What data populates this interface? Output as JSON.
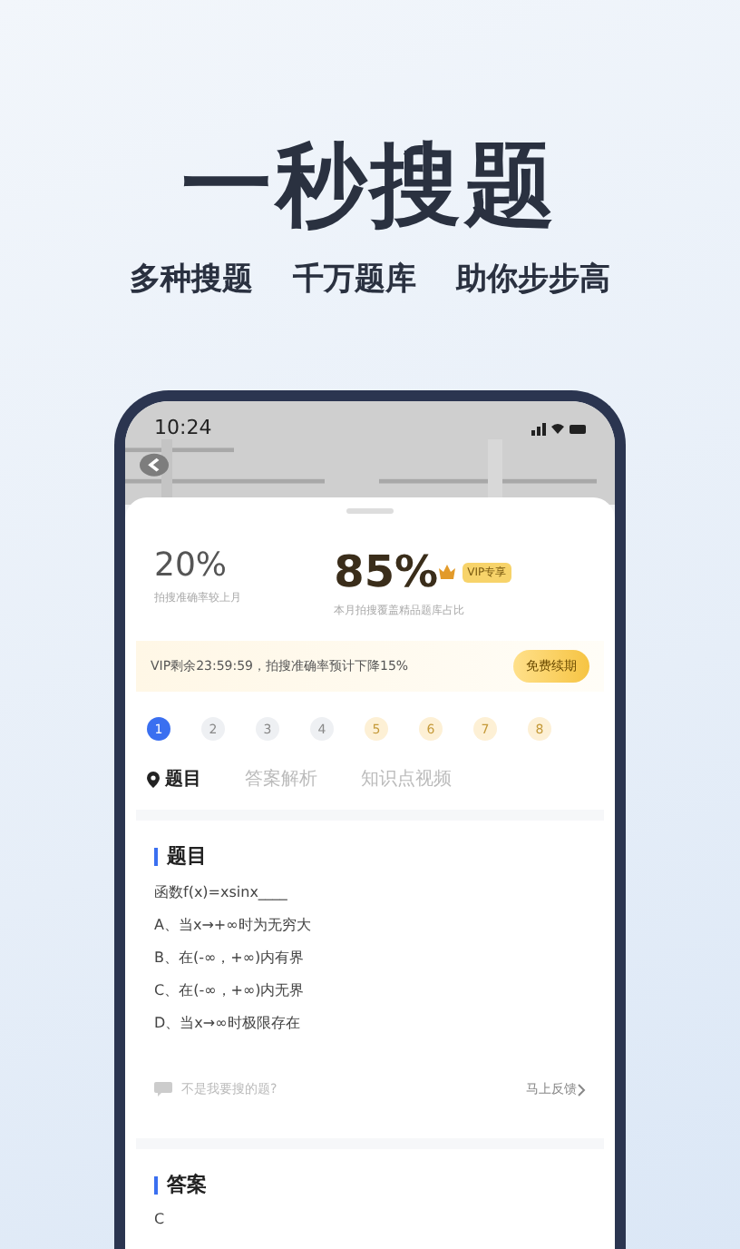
{
  "headline": "一秒搜题",
  "taglines": [
    "多种搜题",
    "千万题库",
    "助你步步高"
  ],
  "status_bar": {
    "time": "10:24"
  },
  "camera": {
    "kind": "picture"
  },
  "stats": [
    {
      "value": "20%",
      "caption": "拍搜准确率较上月",
      "highlight": false
    },
    {
      "value": "85%",
      "caption": "本月拍搜覆盖精品题库占比",
      "highlight": true,
      "badge": "VIP专享"
    }
  ],
  "vip_bar": {
    "text": "VIP剩余23:59:59，拍搜准确率预计下降15%",
    "button": "免费续期"
  },
  "questions": [
    {
      "label": "1",
      "selected": true,
      "locked": false
    },
    {
      "label": "2",
      "selected": false,
      "locked": false
    },
    {
      "label": "3",
      "selected": false,
      "locked": false
    },
    {
      "label": "4",
      "selected": false,
      "locked": false
    },
    {
      "label": "5",
      "selected": false,
      "locked": true
    },
    {
      "label": "6",
      "selected": false,
      "locked": true
    },
    {
      "label": "7",
      "selected": false,
      "locked": true
    },
    {
      "label": "8",
      "selected": false,
      "locked": true
    }
  ],
  "tabs": [
    {
      "label": "题目",
      "selected": true
    },
    {
      "label": "答案解析",
      "selected": false
    },
    {
      "label": "知识点视频",
      "selected": false
    }
  ],
  "question_card": {
    "title": "题目",
    "stem": "函数f(x)=xsinx____",
    "options": [
      "A、当x→+∞时为无穷大",
      "B、在(-∞，+∞)内有界",
      "C、在(-∞，+∞)内无界",
      "D、当x→∞时极限存在"
    ],
    "feedback_hint": "不是我要搜的题?",
    "feedback_link": "马上反馈"
  },
  "answer_card": {
    "title": "答案",
    "answer": "C"
  }
}
